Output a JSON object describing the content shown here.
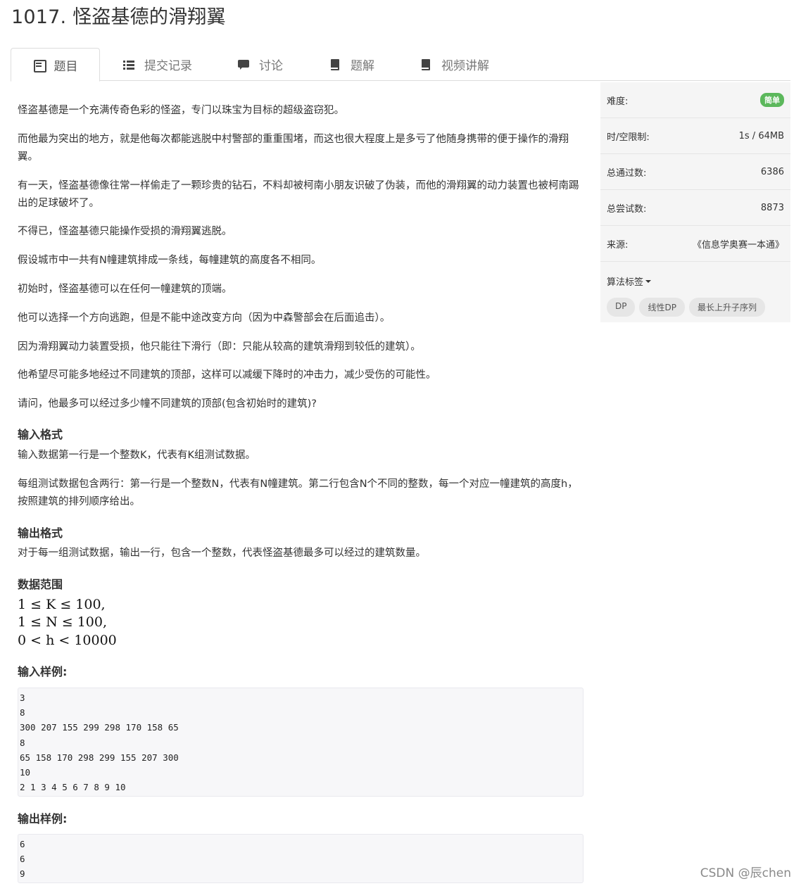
{
  "page": {
    "title": "1017. 怪盗基德的滑翔翼"
  },
  "tabs": [
    {
      "label": "题目",
      "icon": "list-icon",
      "active": true
    },
    {
      "label": "提交记录",
      "icon": "lines-icon"
    },
    {
      "label": "讨论",
      "icon": "chat-icon"
    },
    {
      "label": "题解",
      "icon": "book-icon"
    },
    {
      "label": "视频讲解",
      "icon": "book-icon"
    }
  ],
  "problem": {
    "paragraphs": [
      "怪盗基德是一个充满传奇色彩的怪盗，专门以珠宝为目标的超级盗窃犯。",
      "而他最为突出的地方，就是他每次都能逃脱中村警部的重重围堵，而这也很大程度上是多亏了他随身携带的便于操作的滑翔翼。",
      "有一天，怪盗基德像往常一样偷走了一颗珍贵的钻石，不料却被柯南小朋友识破了伪装，而他的滑翔翼的动力装置也被柯南踢出的足球破坏了。",
      "不得已，怪盗基德只能操作受损的滑翔翼逃脱。",
      "假设城市中一共有N幢建筑排成一条线，每幢建筑的高度各不相同。",
      "初始时，怪盗基德可以在任何一幢建筑的顶端。",
      "他可以选择一个方向逃跑，但是不能中途改变方向（因为中森警部会在后面追击）。",
      "因为滑翔翼动力装置受损，他只能往下滑行（即：只能从较高的建筑滑翔到较低的建筑）。",
      "他希望尽可能多地经过不同建筑的顶部，这样可以减缓下降时的冲击力，减少受伤的可能性。",
      "请问，他最多可以经过多少幢不同建筑的顶部(包含初始时的建筑)?"
    ],
    "input_format": {
      "heading": "输入格式",
      "lines": [
        "输入数据第一行是一个整数K，代表有K组测试数据。",
        "每组测试数据包含两行：第一行是一个整数N，代表有N幢建筑。第二行包含N个不同的整数，每一个对应一幢建筑的高度h，按照建筑的排列顺序给出。"
      ]
    },
    "output_format": {
      "heading": "输出格式",
      "lines": [
        "对于每一组测试数据，输出一行，包含一个整数，代表怪盗基德最多可以经过的建筑数量。"
      ]
    },
    "data_range": {
      "heading": "数据范围",
      "lines": [
        "1 ≤ K ≤ 100,",
        "1 ≤ N ≤ 100,",
        "0 < h < 10000"
      ]
    },
    "sample_input": {
      "heading": "输入样例:",
      "text": "3\n8\n300 207 155 299 298 170 158 65\n8\n65 158 170 298 299 155 207 300\n10\n2 1 3 4 5 6 7 8 9 10"
    },
    "sample_output": {
      "heading": "输出样例:",
      "text": "6\n6\n9"
    }
  },
  "sidebar": {
    "difficulty_label": "难度:",
    "difficulty_value": "简单",
    "difficulty_color": "#5cb85c",
    "limit_label": "时/空限制:",
    "limit_value": "1s / 64MB",
    "passed_label": "总通过数:",
    "passed_value": "6386",
    "attempts_label": "总尝试数:",
    "attempts_value": "8873",
    "source_label": "来源:",
    "source_value": "《信息学奥赛一本通》",
    "tags_label": "算法标签",
    "tags": [
      "DP",
      "线性DP",
      "最长上升子序列"
    ]
  },
  "watermark": "CSDN @辰chen"
}
